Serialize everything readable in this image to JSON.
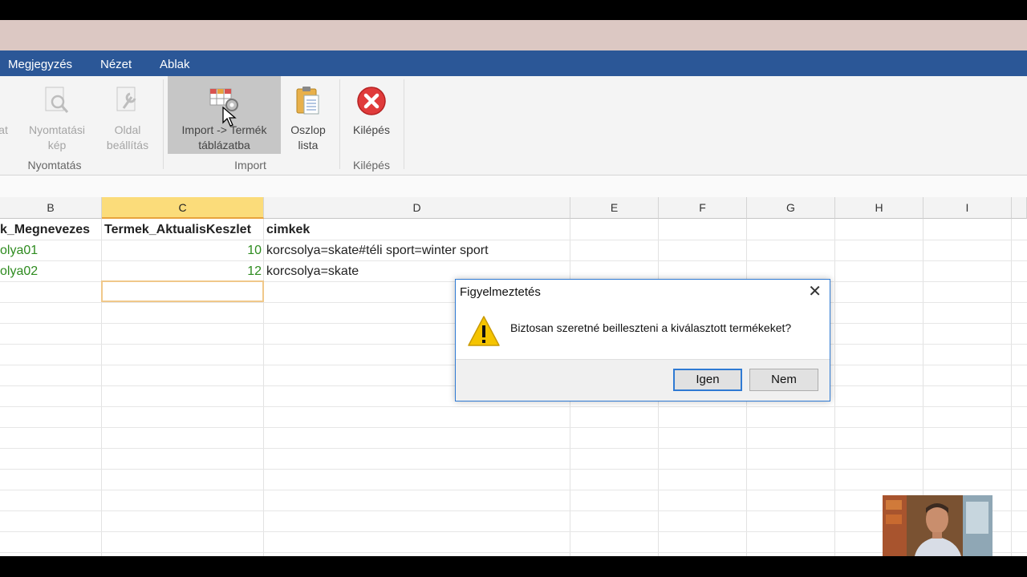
{
  "menu": [
    "Megjegyzés",
    "Nézet",
    "Ablak"
  ],
  "ribbon": {
    "partial_label": "at",
    "print_preview": {
      "line1": "Nyomtatási",
      "line2": "kép"
    },
    "page_setup": {
      "line1": "Oldal",
      "line2": "beállítás"
    },
    "group_print": "Nyomtatás",
    "import_product": {
      "line1": "Import -> Termék",
      "line2": "táblázatba"
    },
    "column_list": {
      "line1": "Oszlop",
      "line2": "lista"
    },
    "group_import": "Import",
    "exit_button": "Kilépés",
    "group_exit": "Kilépés"
  },
  "sheet": {
    "columns": [
      "B",
      "C",
      "D",
      "E",
      "F",
      "G",
      "H",
      "I"
    ],
    "header_row": {
      "b": "k_Megnevezes",
      "c": "Termek_AktualisKeszlet",
      "d": "cimkek"
    },
    "rows": [
      {
        "b": "olya01",
        "c": "10",
        "d": "korcsolya=skate#téli sport=winter sport"
      },
      {
        "b": "olya02",
        "c": "12",
        "d": "korcsolya=skate"
      }
    ]
  },
  "dialog": {
    "title": "Figyelmeztetés",
    "message": "Biztosan szeretné beilleszteni a kiválasztott termékeket?",
    "yes": "Igen",
    "no": "Nem",
    "close": "✕"
  },
  "colors": {
    "menubar": "#2b5797",
    "selected_col": "#fbdc7a",
    "green_text": "#2e8b1f",
    "dialog_border": "#2f7ad3"
  }
}
